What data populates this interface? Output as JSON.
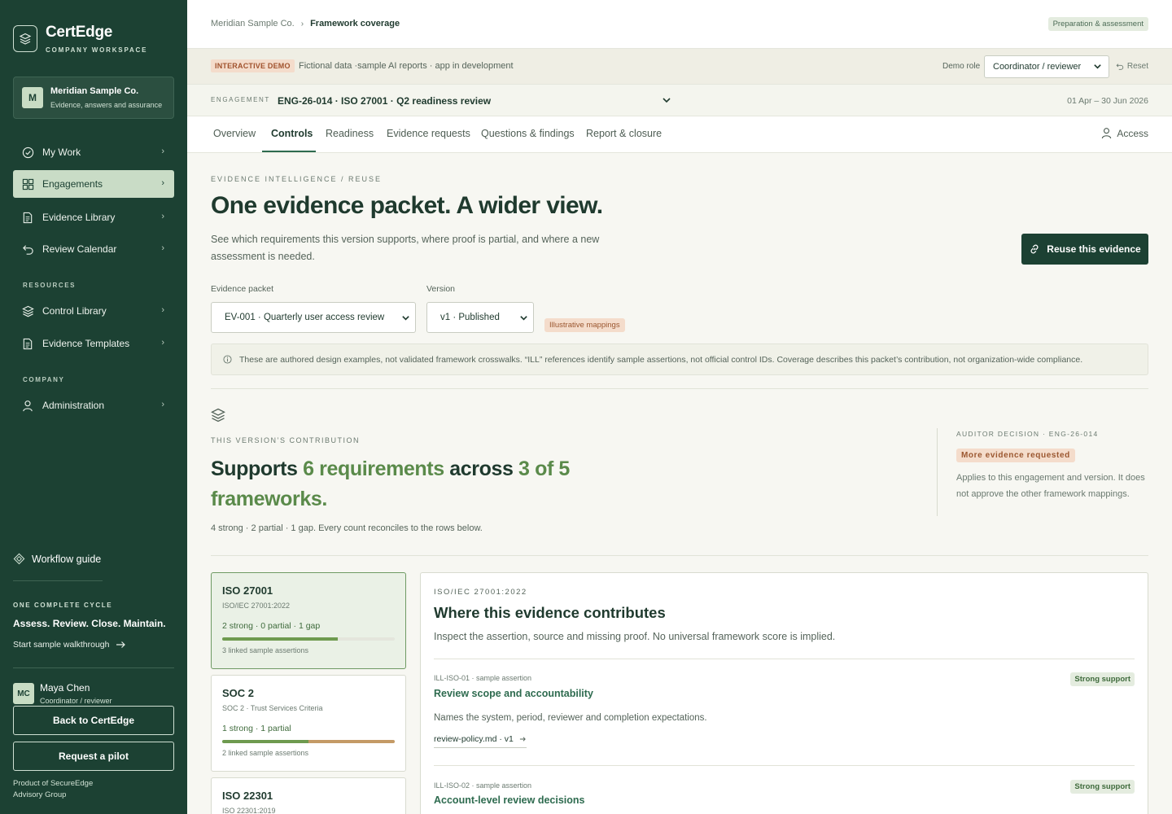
{
  "sidebar": {
    "brand_title": "CertEdge",
    "brand_sub": "COMPANY WORKSPACE",
    "company": {
      "initial": "M",
      "name": "Meridian Sample Co.",
      "desc": "Evidence, answers and assurance"
    },
    "nav": [
      {
        "label": "My Work",
        "icon": "check-circle-icon"
      },
      {
        "label": "Engagements",
        "icon": "grid-icon",
        "active": true
      },
      {
        "label": "Evidence Library",
        "icon": "document-icon"
      },
      {
        "label": "Review Calendar",
        "icon": "undo-arrow-icon"
      }
    ],
    "resources_label": "RESOURCES",
    "resources": [
      {
        "label": "Control Library",
        "icon": "layers-icon"
      },
      {
        "label": "Evidence Templates",
        "icon": "document-icon"
      }
    ],
    "company_label": "COMPANY",
    "company_nav": [
      {
        "label": "Administration",
        "icon": "user-icon"
      }
    ],
    "workflow_guide": "Workflow guide",
    "cycle_label": "ONE COMPLETE CYCLE",
    "cycle_text": "Assess. Review. Close. Maintain.",
    "walkthrough": "Start sample walkthrough",
    "user": {
      "initials": "MC",
      "name": "Maya Chen",
      "role": "Coordinator / reviewer"
    },
    "back_button": "Back to CertEdge",
    "pilot_button": "Request a pilot",
    "product_note": "Product of SecureEdge Advisory Group"
  },
  "topbar": {
    "breadcrumb_root": "Meridian Sample Co.",
    "breadcrumb_current": "Framework coverage",
    "phase_badge": "Preparation & assessment"
  },
  "demo": {
    "badge": "INTERACTIVE DEMO",
    "text": "Fictional data ·sample AI reports · app in development",
    "role_label": "Demo role",
    "role_value": "Coordinator / reviewer",
    "reset": "Reset"
  },
  "engagement": {
    "label": "ENGAGEMENT",
    "value": "ENG-26-014 · ISO 27001 · Q2 readiness review",
    "dates": "01 Apr – 30 Jun 2026"
  },
  "tabs": [
    "Overview",
    "Controls",
    "Readiness",
    "Evidence requests",
    "Questions & findings",
    "Report & closure"
  ],
  "active_tab": "Controls",
  "access": "Access",
  "page": {
    "eyebrow": "EVIDENCE INTELLIGENCE / REUSE",
    "title": "One evidence packet. A wider view.",
    "desc": "See which requirements this version supports, where proof is partial, and where a new assessment is needed.",
    "reuse_button": "Reuse this evidence",
    "packet_label": "Evidence packet",
    "packet_value": "EV-001 · Quarterly user access review",
    "version_label": "Version",
    "version_value": "v1 · Published",
    "illustrative_badge": "Illustrative mappings",
    "info": "These are authored design examples, not validated framework crosswalks. “ILL” references identify sample assertions, not official control IDs. Coverage describes this packet’s contribution, not organization-wide compliance."
  },
  "contribution": {
    "label": "THIS VERSION’S CONTRIBUTION",
    "title_pre": "Supports ",
    "title_hl1": "6 requirements",
    "title_mid": " across ",
    "title_hl2": "3 of 5 frameworks.",
    "sub": "4 strong · 2 partial · 1 gap. Every count reconciles to the rows below."
  },
  "auditor": {
    "label": "AUDITOR DECISION · ENG-26-014",
    "badge": "More evidence requested",
    "note": "Applies to this engagement and version. It does not approve the other framework mappings."
  },
  "frameworks": [
    {
      "name": "ISO 27001",
      "std": "ISO/IEC 27001:2022",
      "counts": "2 strong · 0 partial · 1 gap",
      "strong": 0.67,
      "partial": 0,
      "links": "3 linked sample assertions",
      "active": true
    },
    {
      "name": "SOC 2",
      "std": "SOC 2 · Trust Services Criteria",
      "counts": "1 strong · 1 partial",
      "strong": 0.5,
      "partial": 0.5,
      "links": "2 linked sample assertions"
    },
    {
      "name": "ISO 22301",
      "std": "ISO 22301:2019"
    }
  ],
  "detail": {
    "std": "ISO/IEC 27001:2022",
    "title": "Where this evidence contributes",
    "desc": "Inspect the assertion, source and missing proof. No universal framework score is implied.",
    "assertions": [
      {
        "meta": "ILL-ISO-01 · sample assertion",
        "title": "Review scope and accountability",
        "desc": "Names the system, period, reviewer and completion expectations.",
        "link": "review-policy.md · v1",
        "badge": "Strong support"
      },
      {
        "meta": "ILL-ISO-02 · sample assertion",
        "title": "Account-level review decisions",
        "badge": "Strong support"
      }
    ]
  },
  "colors": {
    "sidebar": "#1c4133",
    "accent": "#2e6b4f",
    "strong": "#6e9a4f",
    "partial": "#c49a66"
  }
}
